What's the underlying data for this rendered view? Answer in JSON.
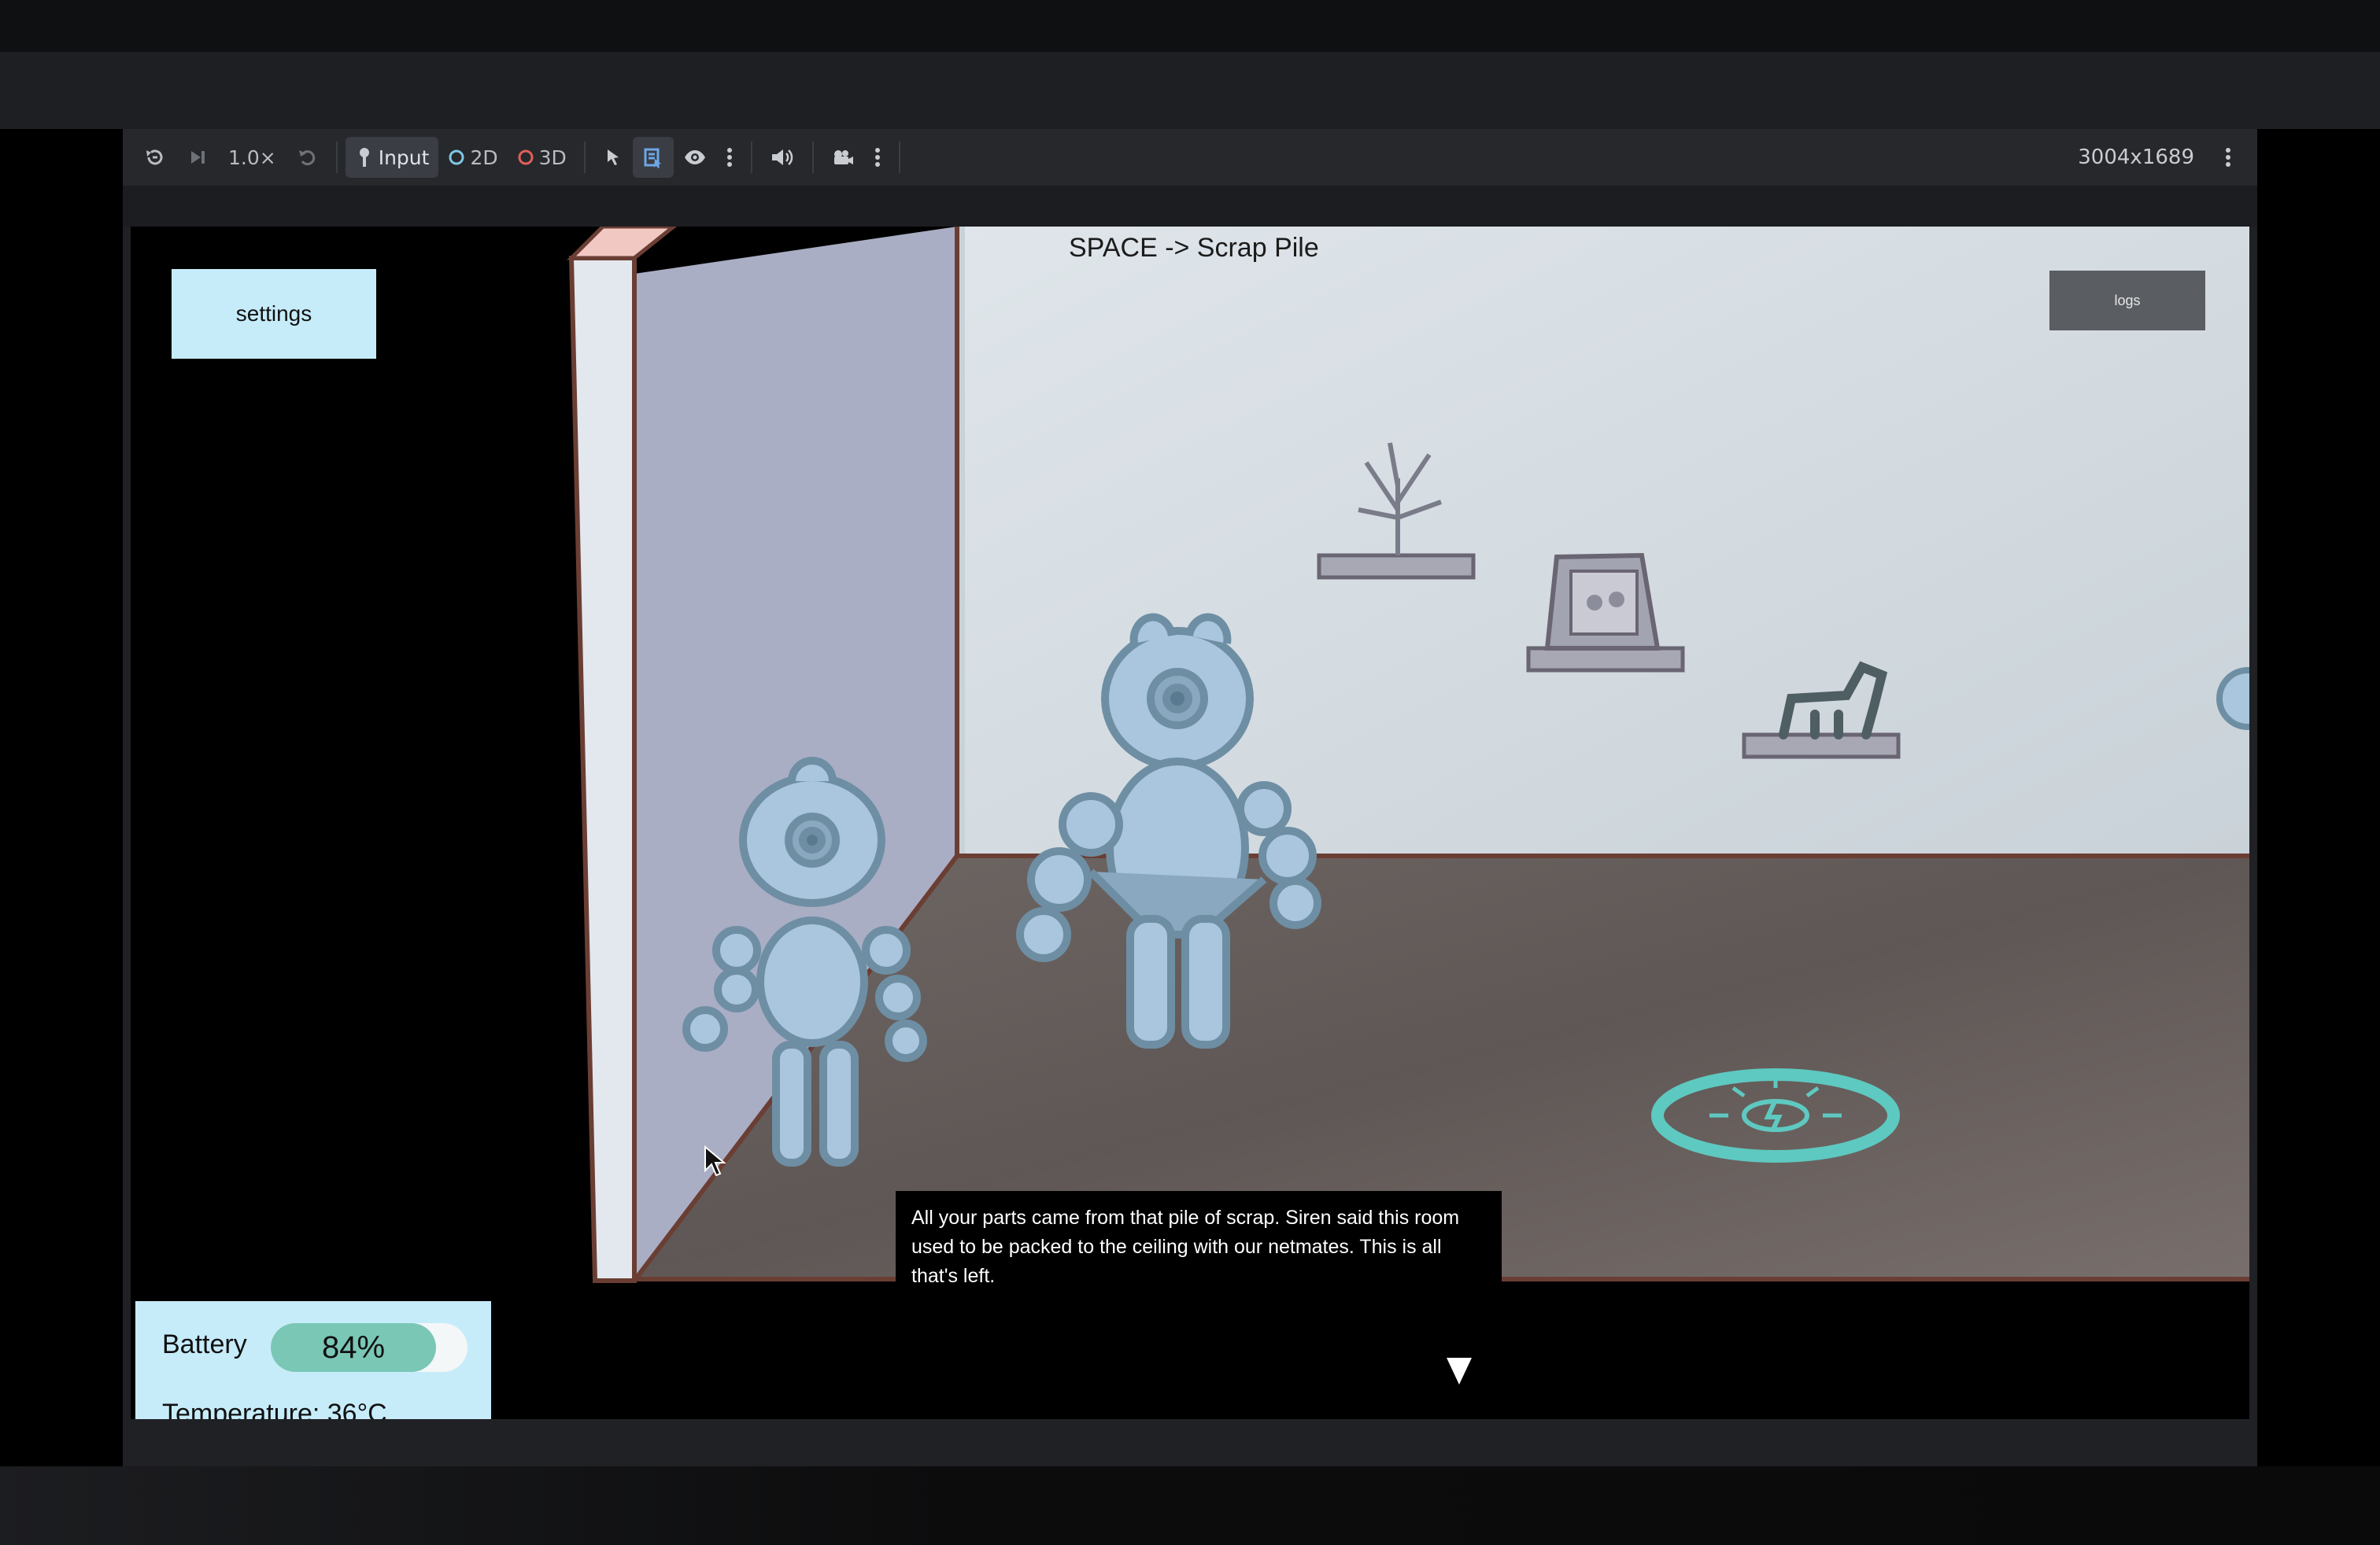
{
  "toolbar": {
    "speed_label": "1.0×",
    "input_label": "Input",
    "mode_2d_label": "2D",
    "mode_3d_label": "3D",
    "resolution": "3004x1689"
  },
  "game": {
    "room_title": "SPACE -> Scrap Pile",
    "settings_label": "settings",
    "logs_label": "logs",
    "status": {
      "battery_label": "Battery",
      "battery_value": "84%",
      "battery_level": 0.84,
      "temperature_label": "Temperature: 36°C"
    },
    "dialogue": {
      "text": "All your parts came from that pile of scrap. Siren said this room used to be packed to the ceiling with our netmates. This is all that's left."
    }
  },
  "colors": {
    "panel_bg": "#c6ecfa",
    "battery_fill": "#7ac7b6",
    "robot": "#a9c6de",
    "robot_outline": "#6e8ea4",
    "charger_ring": "#5ec9c0",
    "floor": "#6c6462",
    "wall": "#d6dde3"
  },
  "icons": {
    "rewind": "rewind-icon",
    "step": "step-forward-icon",
    "reset": "undo-icon",
    "input": "joystick-icon",
    "select": "cursor-select-icon",
    "list": "list-select-icon",
    "visibility": "eye-icon",
    "audio": "speaker-icon",
    "camera": "camera-icon",
    "more": "kebab-menu-icon"
  }
}
